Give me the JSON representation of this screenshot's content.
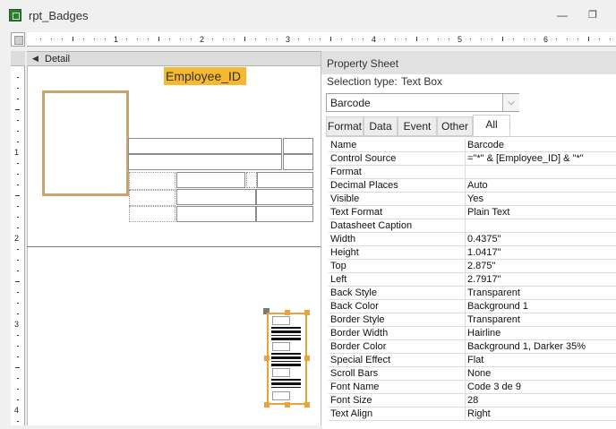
{
  "window": {
    "title": "rpt_Badges",
    "minimize_glyph": "—",
    "restore_glyph": "❐"
  },
  "ruler": {
    "h_labels": [
      "1",
      "2",
      "3",
      "4",
      "5",
      "6"
    ],
    "v_labels": [
      "1",
      "2",
      "3",
      "4"
    ]
  },
  "section": {
    "label": "Detail",
    "arrow": "◀"
  },
  "canvas": {
    "employee_id_label": "Employee_ID"
  },
  "property_sheet": {
    "title": "Property Sheet",
    "selection_type_label": "Selection type:",
    "selection_type_value": "Text Box",
    "selected_control": "Barcode",
    "dropdown_arrow": "⌵",
    "tabs": [
      {
        "label": "Format"
      },
      {
        "label": "Data"
      },
      {
        "label": "Event"
      },
      {
        "label": "Other"
      },
      {
        "label": "All",
        "active": true
      }
    ],
    "rows": [
      {
        "name": "Name",
        "value": "Barcode"
      },
      {
        "name": "Control Source",
        "value": "=\"*\" & [Employee_ID] & \"*\""
      },
      {
        "name": "Format",
        "value": ""
      },
      {
        "name": "Decimal Places",
        "value": "Auto"
      },
      {
        "name": "Visible",
        "value": "Yes"
      },
      {
        "name": "Text Format",
        "value": "Plain Text"
      },
      {
        "name": "Datasheet Caption",
        "value": ""
      },
      {
        "name": "Width",
        "value": "0.4375\""
      },
      {
        "name": "Height",
        "value": "1.0417\""
      },
      {
        "name": "Top",
        "value": "2.875\""
      },
      {
        "name": "Left",
        "value": "2.7917\""
      },
      {
        "name": "Back Style",
        "value": "Transparent"
      },
      {
        "name": "Back Color",
        "value": "Background 1"
      },
      {
        "name": "Border Style",
        "value": "Transparent"
      },
      {
        "name": "Border Width",
        "value": "Hairline"
      },
      {
        "name": "Border Color",
        "value": "Background 1, Darker 35%"
      },
      {
        "name": "Special Effect",
        "value": "Flat"
      },
      {
        "name": "Scroll Bars",
        "value": "None"
      },
      {
        "name": "Font Name",
        "value": "Code 3 de 9"
      },
      {
        "name": "Font Size",
        "value": "28"
      },
      {
        "name": "Text Align",
        "value": "Right"
      }
    ]
  },
  "colors": {
    "accent_orange": "#f5b830",
    "photo_frame": "#c9a46c",
    "selection": "#e8a33a"
  }
}
